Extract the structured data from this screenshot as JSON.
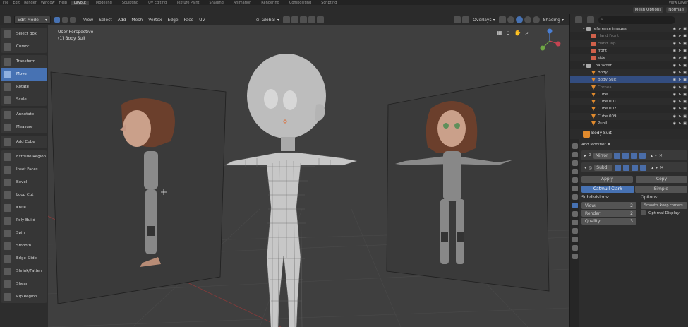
{
  "topbar": {
    "menus": [
      "File",
      "Edit",
      "Render",
      "Window",
      "Help"
    ],
    "workspaces": [
      "Layout",
      "Modeling",
      "Sculpting",
      "UV Editing",
      "Texture Paint",
      "Shading",
      "Animation",
      "Rendering",
      "Compositing",
      "Scripting"
    ],
    "active_workspace": "Layout",
    "view_layer": "View Layer"
  },
  "header": {
    "mode": "Edit Mode",
    "menus": [
      "View",
      "Select",
      "Add",
      "Mesh",
      "Vertex",
      "Edge",
      "Face",
      "UV"
    ],
    "transform_orientation": "Global",
    "overlays": "Overlays",
    "shading": "Shading",
    "mesh_options": "Mesh Options",
    "normals": "Normals"
  },
  "viewport": {
    "view_name": "User Perspective",
    "object_name": "(1) Body Suit",
    "gizmo_axes": [
      "X",
      "Y",
      "Z"
    ]
  },
  "toolbar": {
    "groups": [
      [
        "Select Box",
        "Cursor"
      ],
      [
        "Transform",
        "Move",
        "Rotate",
        "Scale"
      ],
      [
        "Annotate",
        "Measure"
      ],
      [
        "Add Cube"
      ],
      [
        "Extrude Region",
        "Inset Faces",
        "Bevel",
        "Loop Cut",
        "Knife",
        "Poly Build",
        "Spin",
        "Smooth",
        "Edge Slide",
        "Shrink/Fatten",
        "Shear",
        "Rip Region"
      ]
    ],
    "active_tool": "Move"
  },
  "outliner": {
    "rows": [
      {
        "name": "reference images",
        "type": "col",
        "indent": 1
      },
      {
        "name": "Hand Front",
        "type": "img",
        "indent": 2,
        "dim": true
      },
      {
        "name": "Hand Top",
        "type": "img",
        "indent": 2,
        "dim": true
      },
      {
        "name": "front",
        "type": "img",
        "indent": 2
      },
      {
        "name": "side",
        "type": "img",
        "indent": 2
      },
      {
        "name": "Character",
        "type": "col",
        "indent": 1
      },
      {
        "name": "Body",
        "type": "mesh",
        "indent": 2
      },
      {
        "name": "Body Suit",
        "type": "mesh",
        "indent": 2,
        "selected": true
      },
      {
        "name": "Cornea",
        "type": "mesh",
        "indent": 2,
        "dim": true
      },
      {
        "name": "Cube",
        "type": "mesh",
        "indent": 2
      },
      {
        "name": "Cube.001",
        "type": "mesh",
        "indent": 2
      },
      {
        "name": "Cube.002",
        "type": "mesh",
        "indent": 2
      },
      {
        "name": "Cube.009",
        "type": "mesh",
        "indent": 2
      },
      {
        "name": "Pupil",
        "type": "mesh",
        "indent": 2
      }
    ]
  },
  "properties": {
    "object_name": "Body Suit",
    "add_modifier": "Add Modifier",
    "modifiers": [
      {
        "name": "Mirror",
        "expanded": false
      },
      {
        "name": "Subdi",
        "expanded": true
      }
    ],
    "apply_label": "Apply",
    "copy_label": "Copy",
    "subdiv_types": [
      "Catmull-Clark",
      "Simple"
    ],
    "active_subdiv_type": "Catmull-Clark",
    "subdivisions_label": "Subdivisions:",
    "options_label": "Options:",
    "view_label": "View:",
    "view_value": "2",
    "render_label": "Render:",
    "render_value": "2",
    "quality_label": "Quality:",
    "quality_value": "3",
    "smooth_label": "Smooth, keep corners",
    "optimal_display_label": "Optimal Display"
  },
  "colors": {
    "accent": "#4772b3",
    "mesh_icon": "#e08a2d",
    "selected_row": "#334d80"
  }
}
